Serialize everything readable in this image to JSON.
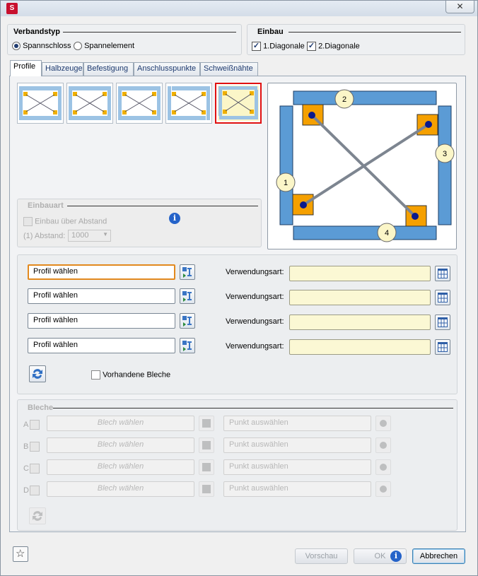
{
  "window": {
    "app_icon": "app-logo-icon",
    "close_glyph": "✕"
  },
  "verbandstyp": {
    "title": "Verbandstyp",
    "options": [
      "Spannschloss",
      "Spannelement"
    ],
    "selected": "Spannschloss"
  },
  "einbau": {
    "title": "Einbau",
    "options": [
      {
        "label": "1.Diagonale",
        "checked": true
      },
      {
        "label": "2.Diagonale",
        "checked": true
      }
    ]
  },
  "tabs": [
    "Profile",
    "Halbzeuge",
    "Befestigung",
    "Anschlusspunkte",
    "Schweißnähte"
  ],
  "active_tab": "Profile",
  "einbauart": {
    "title": "Einbauart",
    "checkbox_label": "Einbau über Abstand",
    "abstand_label": "(1) Abstand:",
    "abstand_value": "1000"
  },
  "preview": {
    "markers": [
      "1",
      "2",
      "3",
      "4"
    ]
  },
  "profile_rows": [
    {
      "value": "Profil wählen",
      "usage_label": "Verwendungsart:",
      "usage_value": ""
    },
    {
      "value": "Profil wählen",
      "usage_label": "Verwendungsart:",
      "usage_value": ""
    },
    {
      "value": "Profil wählen",
      "usage_label": "Verwendungsart:",
      "usage_value": ""
    },
    {
      "value": "Profil wählen",
      "usage_label": "Verwendungsart:",
      "usage_value": ""
    }
  ],
  "vorhandene_bleche": "Vorhandene Bleche",
  "bleche": {
    "title": "Bleche",
    "rows": [
      {
        "letter": "A",
        "blech": "Blech wählen",
        "punkt": "Punkt auswählen"
      },
      {
        "letter": "B",
        "blech": "Blech wählen",
        "punkt": "Punkt auswählen"
      },
      {
        "letter": "C",
        "blech": "Blech wählen",
        "punkt": "Punkt auswählen"
      },
      {
        "letter": "D",
        "blech": "Blech wählen",
        "punkt": "Punkt auswählen"
      }
    ]
  },
  "footer": {
    "vorschau": "Vorschau",
    "ok": "OK",
    "abbrechen": "Abbrechen"
  },
  "colors": {
    "accent": "#e2891e",
    "profile_blue": "#4a90d9",
    "node_orange": "#f5a000",
    "selection_red": "#e01010"
  }
}
